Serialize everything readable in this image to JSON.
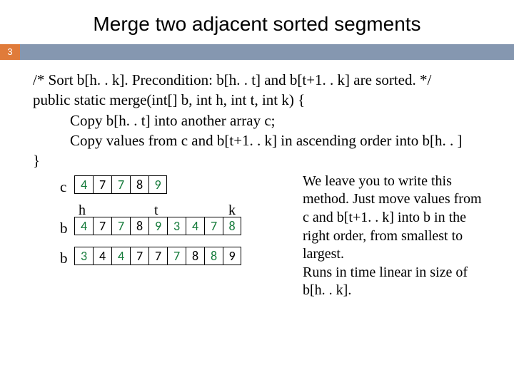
{
  "title": "Merge two adjacent sorted segments",
  "page_number": "3",
  "code": {
    "l1": "/* Sort b[h. . k]. Precondition: b[h. . t] and b[t+1. . k] are sorted.  */",
    "l2": "public static merge(int[] b, int h, int t, int k) {",
    "l3": "Copy b[h. . t] into another array c;",
    "l4": "Copy values from c and b[t+1. . k] in ascending order into b[h. . ]",
    "l5": "}"
  },
  "arrays": {
    "c_label": "c",
    "c": [
      "4",
      "7",
      "7",
      "8",
      "9"
    ],
    "headers": {
      "h": "h",
      "t": "t",
      "k": "k"
    },
    "b1_label": "b",
    "b1": [
      "4",
      "7",
      "7",
      "8",
      "9",
      "3",
      "4",
      "7",
      "8"
    ],
    "b2_label": "b",
    "b2": [
      "3",
      "4",
      "4",
      "7",
      "7",
      "7",
      "8",
      "8",
      "9"
    ]
  },
  "note": "We leave you to write this method. Just move values from c and b[t+1. . k] into b in the right order, from smallest to largest.\nRuns in time linear in size of b[h. . k]."
}
